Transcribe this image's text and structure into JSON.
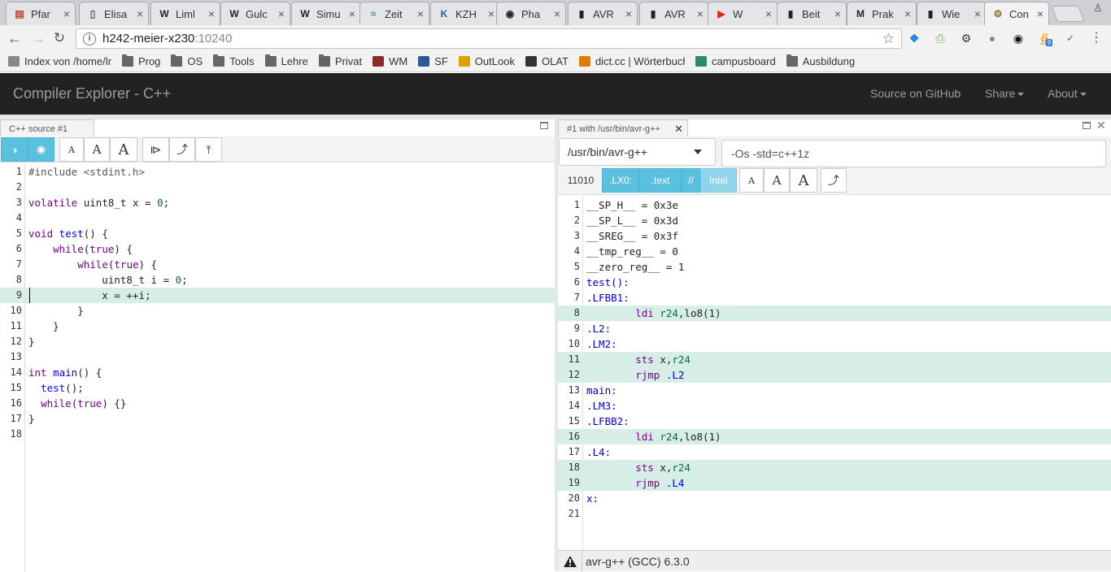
{
  "browser": {
    "tabs": [
      {
        "title": "Pfar",
        "icon": "doc-icon",
        "color": "#c0392b"
      },
      {
        "title": "Elisa",
        "icon": "page-icon",
        "color": "#555555"
      },
      {
        "title": "Liml",
        "icon": "wikipedia-icon",
        "color": "#222222"
      },
      {
        "title": "Gulc",
        "icon": "wikipedia-icon",
        "color": "#222222"
      },
      {
        "title": "Simu",
        "icon": "wikipedia-icon",
        "color": "#222222"
      },
      {
        "title": "Zeit",
        "icon": "chart-icon",
        "color": "#2aa07a"
      },
      {
        "title": "KZH",
        "icon": "kzh-icon",
        "color": "#1f5fa8"
      },
      {
        "title": "Pha",
        "icon": "github-icon",
        "color": "#222222"
      },
      {
        "title": "AVR",
        "icon": "chip-icon",
        "color": "#222222"
      },
      {
        "title": "AVR",
        "icon": "chip-icon",
        "color": "#222222"
      },
      {
        "title": "W",
        "icon": "youtube-icon",
        "color": "#e62117"
      },
      {
        "title": "Beit",
        "icon": "chip-icon",
        "color": "#222222"
      },
      {
        "title": "Prak",
        "icon": "mnm-icon",
        "color": "#222222"
      },
      {
        "title": "Wie",
        "icon": "chip-icon",
        "color": "#222222"
      },
      {
        "title": "Con",
        "icon": "compiler-explorer-icon",
        "color": "#8a6a2a"
      }
    ],
    "url_host": "h242-meier-x230",
    "url_port": ":10240",
    "bookmarks": [
      {
        "label": "Index von /home/lr",
        "icon": "file-icon"
      },
      {
        "label": "Prog",
        "icon": "folder-icon"
      },
      {
        "label": "OS",
        "icon": "folder-icon"
      },
      {
        "label": "Tools",
        "icon": "folder-icon"
      },
      {
        "label": "Lehre",
        "icon": "folder-icon"
      },
      {
        "label": "Privat",
        "icon": "folder-icon"
      },
      {
        "label": "WM",
        "icon": "wm-icon"
      },
      {
        "label": "SF",
        "icon": "sf-icon"
      },
      {
        "label": "OutLook",
        "icon": "outlook-icon"
      },
      {
        "label": "OLAT",
        "icon": "olat-icon"
      },
      {
        "label": "dict.cc | Wörterbuch",
        "icon": "dict-icon"
      },
      {
        "label": "campusboard",
        "icon": "campusboard-icon"
      },
      {
        "label": "Ausbildung",
        "icon": "folder-icon"
      }
    ],
    "extension_badge": "9"
  },
  "app": {
    "brand": "Compiler Explorer - C++",
    "nav": {
      "source": "Source on GitHub",
      "share": "Share",
      "about": "About"
    }
  },
  "editor": {
    "tab_title": "C++ source #1",
    "lines": [
      "#include <stdint.h>",
      "",
      "volatile uint8_t x = 0;",
      "",
      "void test() {",
      "    while(true) {",
      "        while(true) {",
      "            uint8_t i = 0;",
      "            x = ++i;",
      "        }",
      "    }",
      "}",
      "",
      "int main() {",
      "  test();",
      "  while(true) {}",
      "}",
      ""
    ],
    "highlight_line": 9
  },
  "compiler": {
    "tab_title": "#1 with /usr/bin/avr-g++",
    "compiler_select": "/usr/bin/avr-g++",
    "options": "-Os -std=c++1z",
    "filters": {
      "binary": "11010",
      "labels": ".LX0:",
      "directives": ".text",
      "comments": "//",
      "intel": "Intel"
    },
    "lines": [
      "__SP_H__ = 0x3e",
      "__SP_L__ = 0x3d",
      "__SREG__ = 0x3f",
      "__tmp_reg__ = 0",
      "__zero_reg__ = 1",
      "test():",
      ".LFBB1:",
      "        ldi r24,lo8(1)",
      ".L2:",
      ".LM2:",
      "        sts x,r24",
      "        rjmp .L2",
      "main:",
      ".LM3:",
      ".LFBB2:",
      "        ldi r24,lo8(1)",
      ".L4:",
      "        sts x,r24",
      "        rjmp .L4",
      "x:",
      ""
    ],
    "highlight_lines": [
      8,
      11,
      12,
      16,
      18,
      19
    ],
    "status": "avr-g++ (GCC) 6.3.0"
  }
}
